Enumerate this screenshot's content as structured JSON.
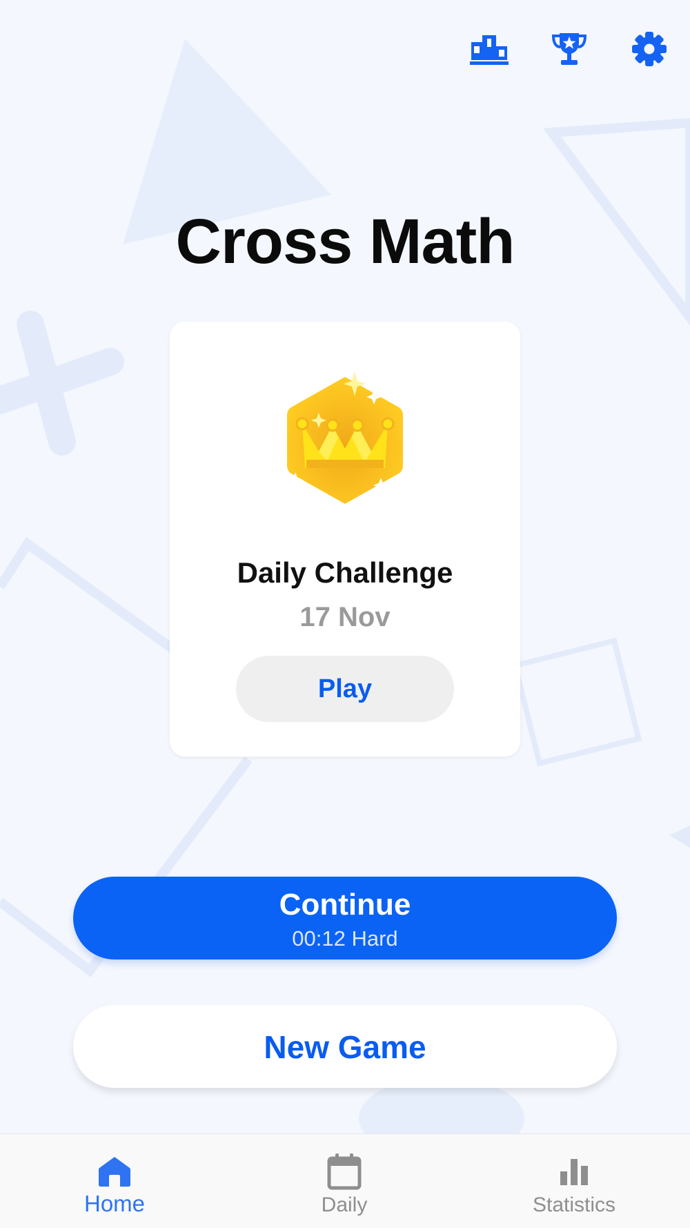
{
  "app": {
    "title": "Cross Math"
  },
  "top_icons": {
    "leaderboard": "podium-icon",
    "trophy": "trophy-icon",
    "settings": "gear-icon"
  },
  "daily_card": {
    "title": "Daily Challenge",
    "date": "17 Nov",
    "play_label": "Play",
    "badge_icon": "crown-badge-icon"
  },
  "actions": {
    "continue_label": "Continue",
    "continue_sub": "00:12 Hard",
    "new_game_label": "New Game"
  },
  "bottom_nav": {
    "items": [
      {
        "label": "Home",
        "icon": "home-icon",
        "active": true
      },
      {
        "label": "Daily",
        "icon": "calendar-icon",
        "active": false
      },
      {
        "label": "Statistics",
        "icon": "bar-chart-icon",
        "active": false
      }
    ]
  },
  "colors": {
    "accent": "#0a63f4",
    "background": "#f4f7fd",
    "gold": "#ffc21a"
  }
}
